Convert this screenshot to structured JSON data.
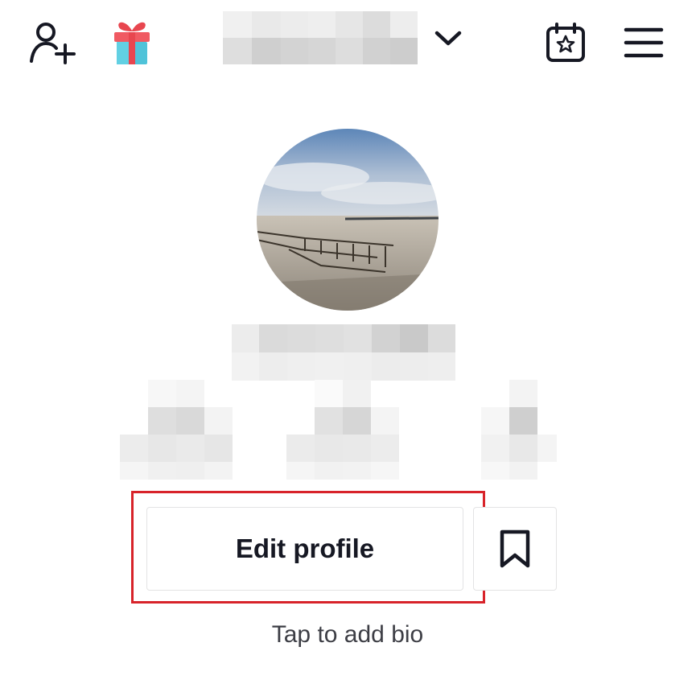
{
  "top_bar": {
    "icons": {
      "add_user": "add-user-icon",
      "gift": "gift-icon",
      "username_chevron": "chevron-down-icon",
      "calendar": "calendar-star-icon",
      "menu": "hamburger-menu-icon"
    },
    "username": ""
  },
  "profile": {
    "avatar": "avatar-photo",
    "display_name": "",
    "stats": [
      {
        "value": "",
        "label": ""
      },
      {
        "value": "",
        "label": ""
      },
      {
        "value": "",
        "label": ""
      }
    ]
  },
  "actions": {
    "edit_profile_label": "Edit profile",
    "favorites_icon": "bookmark-icon"
  },
  "bio_prompt": "Tap to add bio",
  "colors": {
    "highlight_border": "#d8232a",
    "button_border": "#e3e3e4",
    "text_primary": "#161823"
  }
}
